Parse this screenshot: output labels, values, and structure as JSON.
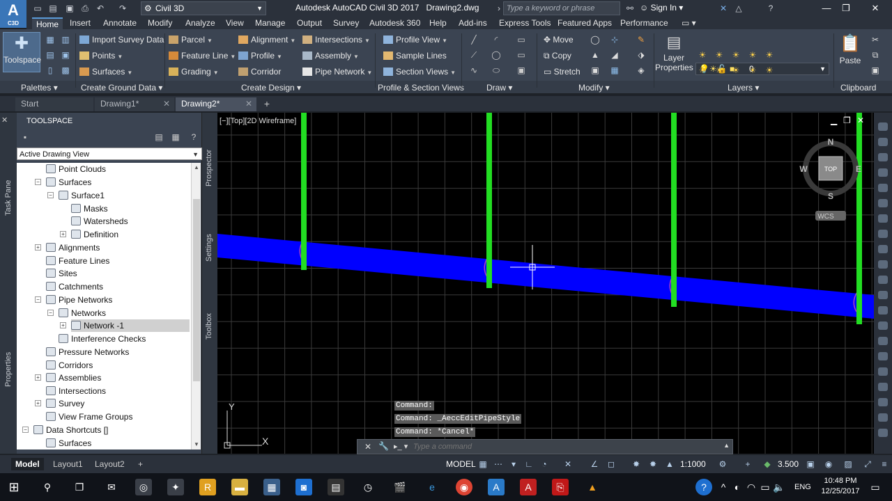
{
  "titlebar": {
    "logo_text": "A",
    "logo_sub": "C3D",
    "workspace": "Civil 3D",
    "app_title": "Autodesk AutoCAD Civil 3D 2017",
    "document": "Drawing2.dwg",
    "search_placeholder": "Type a keyword or phrase",
    "signin": "Sign In"
  },
  "ribbon_tabs": [
    "Home",
    "Insert",
    "Annotate",
    "Modify",
    "Analyze",
    "View",
    "Manage",
    "Output",
    "Survey",
    "Autodesk 360",
    "Help",
    "Add-ins",
    "Express Tools",
    "Featured Apps",
    "Performance"
  ],
  "ribbon": {
    "toolspace": "Toolspace",
    "import_survey": "Import Survey Data",
    "points": "Points",
    "surfaces": "Surfaces",
    "parcel": "Parcel",
    "feature_line": "Feature Line",
    "grading": "Grading",
    "alignment": "Alignment",
    "profile": "Profile",
    "corridor": "Corridor",
    "intersections": "Intersections",
    "assembly": "Assembly",
    "pipe_network": "Pipe Network",
    "profile_view": "Profile View",
    "sample_lines": "Sample Lines",
    "section_views": "Section Views",
    "move": "Move",
    "copy": "Copy",
    "stretch": "Stretch",
    "layer_properties_1": "Layer",
    "layer_properties_2": "Properties",
    "layer_value": "0",
    "paste": "Paste",
    "panels": {
      "palettes": "Palettes",
      "create_ground": "Create Ground Data",
      "create_design": "Create Design",
      "profile_section": "Profile & Section Views",
      "draw": "Draw",
      "modify": "Modify",
      "layers": "Layers",
      "clipboard": "Clipboard"
    }
  },
  "file_tabs": {
    "start": "Start",
    "drawing1": "Drawing1*",
    "drawing2": "Drawing2*"
  },
  "toolspace": {
    "title": "TOOLSPACE",
    "view": "Active Drawing View",
    "side_labels": {
      "task_pane": "Task Pane",
      "properties": "Properties",
      "prospector": "Prospector",
      "settings": "Settings",
      "toolbox": "Toolbox"
    },
    "tree": [
      "Point Clouds",
      "Surfaces",
      "Surface1",
      "Masks",
      "Watersheds",
      "Definition",
      "Alignments",
      "Feature Lines",
      "Sites",
      "Catchments",
      "Pipe Networks",
      "Networks",
      "Network -1",
      "Interference Checks",
      "Pressure Networks",
      "Corridors",
      "Assemblies",
      "Intersections",
      "Survey",
      "View Frame Groups",
      "Data Shortcuts []",
      "Surfaces"
    ]
  },
  "viewport": {
    "label": "[−][Top][2D Wireframe]",
    "compass": {
      "n": "N",
      "s": "S",
      "e": "E",
      "w": "W",
      "top": "TOP",
      "wcs": "WCS"
    },
    "ucs_y": "Y",
    "ucs_x": "X",
    "grid_color": "#3a3a3a",
    "pipe_color": "#0000ff",
    "structure_color": "#22dd22"
  },
  "command": {
    "history": [
      "Command:",
      "Command: _AeccEditPipeStyle",
      "Command: *Cancel*"
    ],
    "placeholder": "Type a command"
  },
  "layout_tabs": [
    "Model",
    "Layout1",
    "Layout2"
  ],
  "statusbar": {
    "model": "MODEL",
    "scale": "1:1000",
    "value": "3.500"
  },
  "taskbar": {
    "lang": "ENG",
    "time": "10:48 PM",
    "date": "12/25/2017"
  }
}
